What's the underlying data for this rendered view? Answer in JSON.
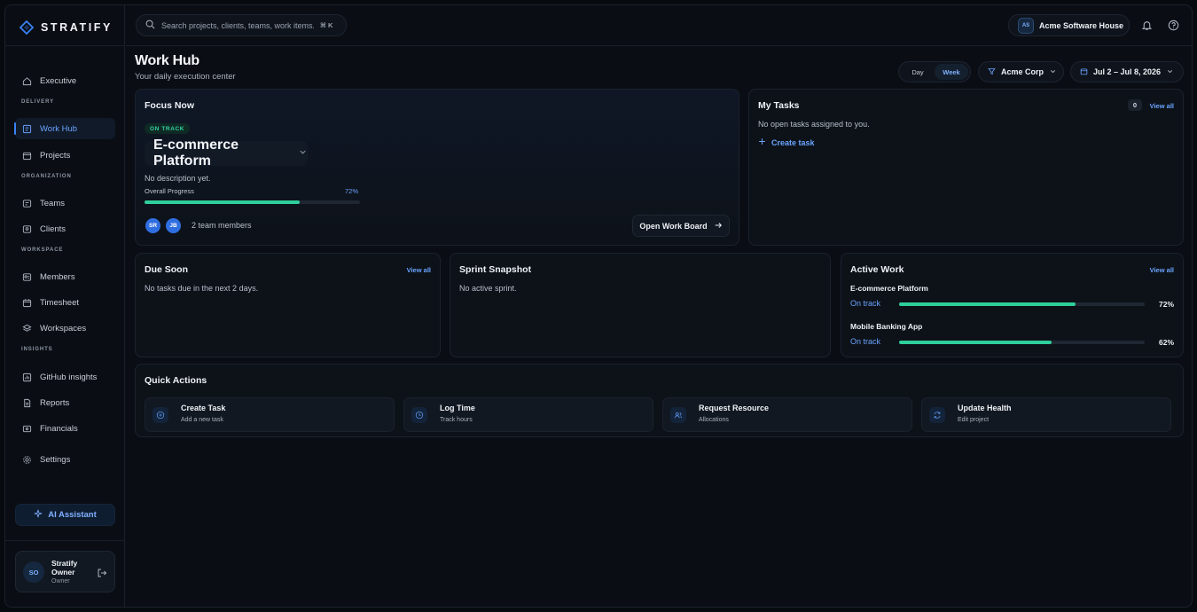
{
  "brand": {
    "name": "STRATIFY"
  },
  "search": {
    "placeholder": "Search projects, clients, teams, work items...",
    "shortcut": "⌘ K"
  },
  "org": {
    "initials": "AS",
    "name": "Acme Software House"
  },
  "sidebar": {
    "executive": "Executive",
    "sections": {
      "delivery": "DELIVERY",
      "organization": "ORGANIZATION",
      "workspace": "WORKSPACE",
      "insights": "INSIGHTS"
    },
    "items": {
      "work_hub": "Work Hub",
      "projects": "Projects",
      "teams": "Teams",
      "clients": "Clients",
      "members": "Members",
      "timesheet": "Timesheet",
      "workspaces": "Workspaces",
      "github": "GitHub insights",
      "reports": "Reports",
      "financials": "Financials",
      "settings": "Settings"
    },
    "ai_button": "AI Assistant",
    "user": {
      "initials": "SO",
      "name": "Stratify Owner",
      "role": "Owner"
    }
  },
  "header": {
    "title": "Work Hub",
    "subtitle": "Your daily execution center",
    "range": {
      "day": "Day",
      "week": "Week"
    },
    "client_filter": "Acme Corp",
    "date_range": "Jul 2 – Jul 8, 2026"
  },
  "focus": {
    "title": "Focus Now",
    "status": "ON TRACK",
    "project": "E-commerce Platform",
    "description": "No description yet.",
    "progress_label": "Overall Progress",
    "progress_text": "72%",
    "progress": 0.72,
    "members": [
      "SR",
      "JB"
    ],
    "members_text": "2 team members",
    "open_board": "Open Work Board"
  },
  "my_tasks": {
    "title": "My Tasks",
    "count": "0",
    "view_all": "View all",
    "empty": "No open tasks assigned to you.",
    "create": "Create task"
  },
  "due_soon": {
    "title": "Due Soon",
    "view_all": "View all",
    "empty": "No tasks due in the next 2 days."
  },
  "sprint": {
    "title": "Sprint Snapshot",
    "empty": "No active sprint."
  },
  "active_work": {
    "title": "Active Work",
    "view_all": "View all",
    "items": [
      {
        "name": "E-commerce Platform",
        "status": "On track",
        "pct_text": "72%",
        "progress": 0.72
      },
      {
        "name": "Mobile Banking App",
        "status": "On track",
        "pct_text": "62%",
        "progress": 0.62
      }
    ]
  },
  "quick_actions": {
    "title": "Quick Actions",
    "items": [
      {
        "title": "Create Task",
        "sub": "Add a new task"
      },
      {
        "title": "Log Time",
        "sub": "Track hours"
      },
      {
        "title": "Request Resource",
        "sub": "Allocations"
      },
      {
        "title": "Update Health",
        "sub": "Edit project"
      }
    ]
  },
  "colors": {
    "accent": "#3b82f6",
    "success": "#2fcf9b",
    "background": "#0a0e14"
  }
}
